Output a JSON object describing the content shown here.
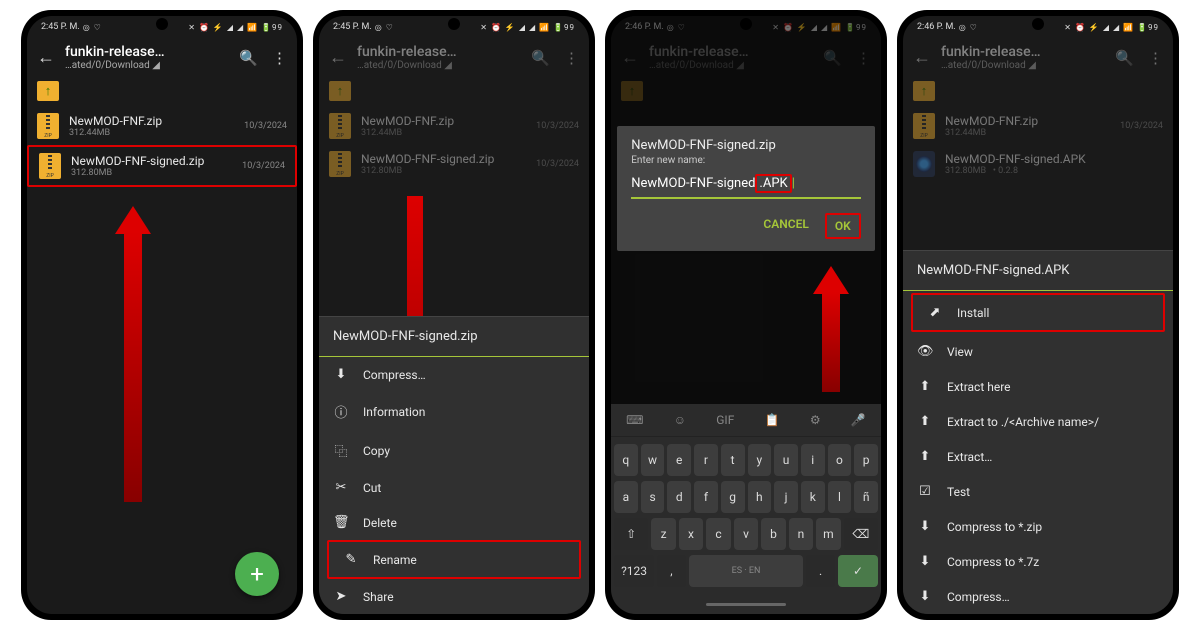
{
  "statusbar": {
    "time1": "2:45 P. M.",
    "time2": "2:45 P. M.",
    "time3": "2:46 P. M.",
    "time4": "2:46 P. M.",
    "left_icons": "◎ ♡",
    "right_icons": "✕ ⏰ ⚡ ◢ ◢ 📶 🔋99"
  },
  "header": {
    "title": "funkin-release…",
    "path": "…ated/0/Download ◢"
  },
  "files": {
    "f1": {
      "name": "NewMOD-FNF.zip",
      "size": "312.44MB",
      "date": "10/3/2024"
    },
    "f2": {
      "name": "NewMOD-FNF-signed.zip",
      "size": "312.80MB",
      "date": "10/3/2024"
    },
    "f3": {
      "name": "NewMOD-FNF-signed.APK",
      "size": "312.80MB",
      "ver": "• 0.2.8"
    }
  },
  "sheet1": {
    "title": "NewMOD-FNF-signed.zip",
    "compress": "Compress…",
    "info": "Information",
    "copy": "Copy",
    "cut": "Cut",
    "delete": "Delete",
    "rename": "Rename",
    "share": "Share"
  },
  "dialog": {
    "title": "NewMOD-FNF-signed.zip",
    "sub": "Enter new name:",
    "input_base": "NewMOD-FNF-signed",
    "input_ext": ".APK",
    "cancel": "CANCEL",
    "ok": "OK"
  },
  "keyboard": {
    "toolbar": [
      "⌨",
      "☺",
      "GIF",
      "📋",
      "⚙",
      "🎤"
    ],
    "r1": [
      "q",
      "w",
      "e",
      "r",
      "t",
      "y",
      "u",
      "i",
      "o",
      "p"
    ],
    "r2": [
      "a",
      "s",
      "d",
      "f",
      "g",
      "h",
      "j",
      "k",
      "l",
      "ñ"
    ],
    "r3_shift": "⇧",
    "r3": [
      "z",
      "x",
      "c",
      "v",
      "b",
      "n",
      "m"
    ],
    "r3_bksp": "⌫",
    "r4_sym": "?123",
    "r4_comma": ",",
    "r4_lang": "ES · EN",
    "r4_dot": ".",
    "r4_enter": "✓"
  },
  "sheet2": {
    "title": "NewMOD-FNF-signed.APK",
    "install": "Install",
    "view": "View",
    "extract_here": "Extract here",
    "extract_named": "Extract to ./<Archive name>/",
    "extract": "Extract…",
    "test": "Test",
    "compress_zip": "Compress to *.zip",
    "compress_7z": "Compress to *.7z",
    "compress": "Compress…"
  }
}
